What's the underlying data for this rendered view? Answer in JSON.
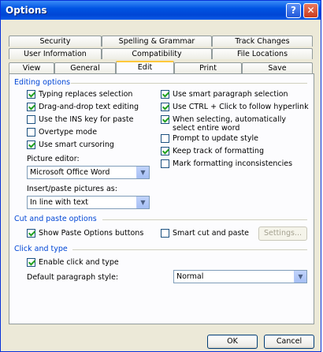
{
  "window": {
    "title": "Options",
    "help": "?",
    "close": "✕"
  },
  "tabs_row1": [
    "Security",
    "Spelling & Grammar",
    "Track Changes"
  ],
  "tabs_row2": [
    "User Information",
    "Compatibility",
    "File Locations"
  ],
  "tabs_row3": [
    "View",
    "General",
    "Edit",
    "Print",
    "Save"
  ],
  "active_tab": "Edit",
  "editing": {
    "heading": "Editing options",
    "left": [
      {
        "label": "Typing replaces selection",
        "checked": true
      },
      {
        "label": "Drag-and-drop text editing",
        "checked": true
      },
      {
        "label": "Use the INS key for paste",
        "checked": false
      },
      {
        "label": "Overtype mode",
        "checked": false
      },
      {
        "label": "Use smart cursoring",
        "checked": true
      }
    ],
    "right": [
      {
        "label": "Use smart paragraph selection",
        "checked": true
      },
      {
        "label": "Use CTRL + Click to follow hyperlink",
        "checked": true
      },
      {
        "label": "When selecting, automatically select entire word",
        "checked": true
      },
      {
        "label": "Prompt to update style",
        "checked": false
      },
      {
        "label": "Keep track of formatting",
        "checked": true
      },
      {
        "label": "Mark formatting inconsistencies",
        "checked": false
      }
    ],
    "picture_editor_label": "Picture editor:",
    "picture_editor_value": "Microsoft Office Word",
    "insert_label": "Insert/paste pictures as:",
    "insert_value": "In line with text"
  },
  "cut_paste": {
    "heading": "Cut and paste options",
    "show_paste": {
      "label": "Show Paste Options buttons",
      "checked": true
    },
    "smart_cut": {
      "label": "Smart cut and paste",
      "checked": false
    },
    "settings_button": "Settings..."
  },
  "click_type": {
    "heading": "Click and type",
    "enable": {
      "label": "Enable click and type",
      "checked": true
    },
    "style_label": "Default paragraph style:",
    "style_value": "Normal"
  },
  "buttons": {
    "ok": "OK",
    "cancel": "Cancel"
  },
  "colors": {
    "titlebar": "#0054E3",
    "group_heading": "#0046D5",
    "check": "#21A121",
    "active_tab_accent": "#FFC83C"
  },
  "icons": {
    "dropdown": "chevron-down-icon",
    "check": "check-icon"
  }
}
